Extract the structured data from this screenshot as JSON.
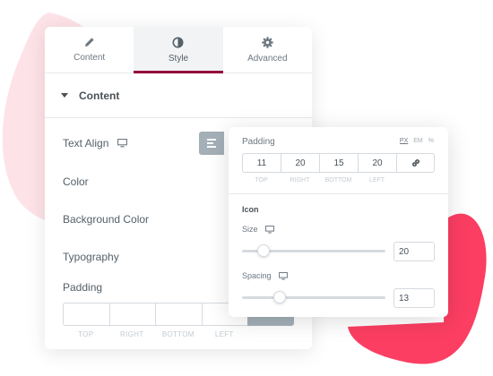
{
  "colors": {
    "accent": "#93003c",
    "blob_left": "#fde3e8",
    "blob_right": "#fb3e62",
    "button_gray": "#a4afb7"
  },
  "tabs": [
    {
      "label": "Content",
      "icon": "pencil-icon",
      "active": false
    },
    {
      "label": "Style",
      "icon": "contrast-icon",
      "active": true
    },
    {
      "label": "Advanced",
      "icon": "gear-icon",
      "active": false
    }
  ],
  "section": {
    "title": "Content"
  },
  "controls": {
    "text_align": "Text Align",
    "color": "Color",
    "background_color": "Background Color",
    "typography": "Typography",
    "padding": "Padding"
  },
  "padding_labels": [
    "TOP",
    "RIGHT",
    "BOTTOM",
    "LEFT"
  ],
  "popup": {
    "padding_title": "Padding",
    "units": [
      "PX",
      "EM",
      "%"
    ],
    "active_unit": "PX",
    "padding_values": [
      "11",
      "20",
      "15",
      "20"
    ],
    "padding_labels": [
      "TOP",
      "RIGHT",
      "BOTTOM",
      "LEFT"
    ],
    "icon_section": "Icon",
    "size": {
      "label": "Size",
      "value": "20",
      "fraction": 0.15
    },
    "spacing": {
      "label": "Spacing",
      "value": "13",
      "fraction": 0.26
    }
  }
}
